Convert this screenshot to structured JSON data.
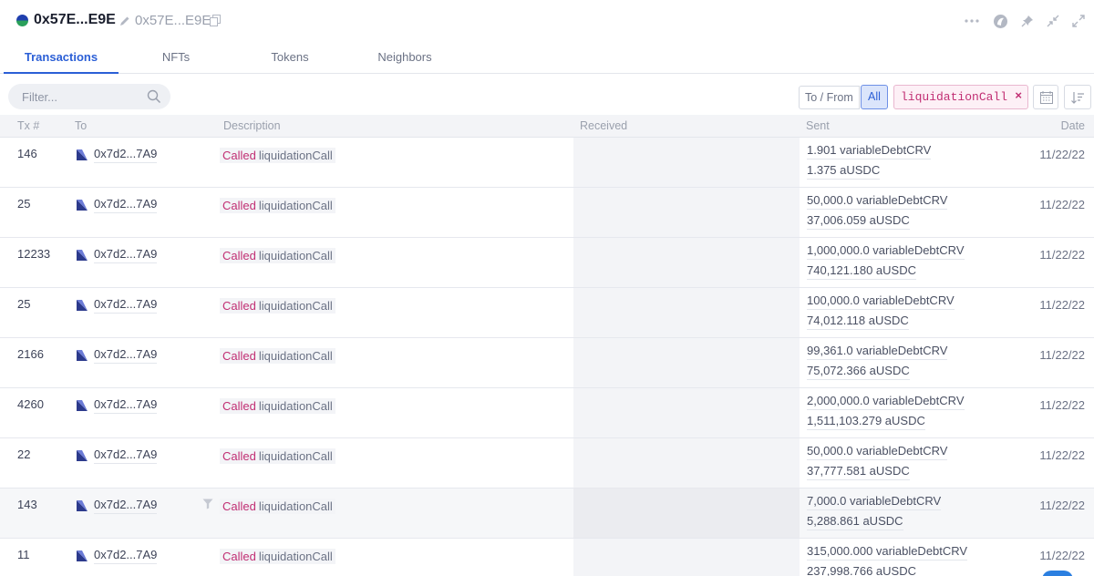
{
  "header": {
    "title": "0x57E...E9E",
    "subtitle": "0x57E...E9E",
    "icons": [
      "more-icon",
      "logo-icon",
      "pin-icon",
      "collapse-icon",
      "expand-icon"
    ]
  },
  "tabs": [
    {
      "label": "Transactions",
      "active": true
    },
    {
      "label": "NFTs",
      "active": false
    },
    {
      "label": "Tokens",
      "active": false
    },
    {
      "label": "Neighbors",
      "active": false
    }
  ],
  "toolbar": {
    "filter_placeholder": "Filter...",
    "to_from_label": "To / From",
    "all_label": "All",
    "chip_label": "liquidationCall",
    "chip_close": "×"
  },
  "columns": {
    "tx": "Tx #",
    "to": "To",
    "description": "Description",
    "received": "Received",
    "sent": "Sent",
    "date": "Date"
  },
  "rows": [
    {
      "tx": "146",
      "to": "0x7d2...7A9",
      "called": "Called",
      "fn": "liquidationCall",
      "sent1": "1.901 variableDebtCRV",
      "sent2": "1.375 aUSDC",
      "date": "11/22/22"
    },
    {
      "tx": "25",
      "to": "0x7d2...7A9",
      "called": "Called",
      "fn": "liquidationCall",
      "sent1": "50,000.0 variableDebtCRV",
      "sent2": "37,006.059 aUSDC",
      "date": "11/22/22"
    },
    {
      "tx": "12233",
      "to": "0x7d2...7A9",
      "called": "Called",
      "fn": "liquidationCall",
      "sent1": "1,000,000.0 variableDebtCRV",
      "sent2": "740,121.180 aUSDC",
      "date": "11/22/22"
    },
    {
      "tx": "25",
      "to": "0x7d2...7A9",
      "called": "Called",
      "fn": "liquidationCall",
      "sent1": "100,000.0 variableDebtCRV",
      "sent2": "74,012.118 aUSDC",
      "date": "11/22/22"
    },
    {
      "tx": "2166",
      "to": "0x7d2...7A9",
      "called": "Called",
      "fn": "liquidationCall",
      "sent1": "99,361.0 variableDebtCRV",
      "sent2": "75,072.366 aUSDC",
      "date": "11/22/22"
    },
    {
      "tx": "4260",
      "to": "0x7d2...7A9",
      "called": "Called",
      "fn": "liquidationCall",
      "sent1": "2,000,000.0 variableDebtCRV",
      "sent2": "1,511,103.279 aUSDC",
      "date": "11/22/22"
    },
    {
      "tx": "22",
      "to": "0x7d2...7A9",
      "called": "Called",
      "fn": "liquidationCall",
      "sent1": "50,000.0 variableDebtCRV",
      "sent2": "37,777.581 aUSDC",
      "date": "11/22/22"
    },
    {
      "tx": "143",
      "to": "0x7d2...7A9",
      "called": "Called",
      "fn": "liquidationCall",
      "sent1": "7,000.0 variableDebtCRV",
      "sent2": "5,288.861 aUSDC",
      "date": "11/22/22"
    },
    {
      "tx": "11",
      "to": "0x7d2...7A9",
      "called": "Called",
      "fn": "liquidationCall",
      "sent1": "315,000.000 variableDebtCRV",
      "sent2": "237,998.766 aUSDC",
      "date": "11/22/22"
    }
  ],
  "colors": {
    "accent": "#2b5fd6",
    "called": "#c12e73"
  }
}
